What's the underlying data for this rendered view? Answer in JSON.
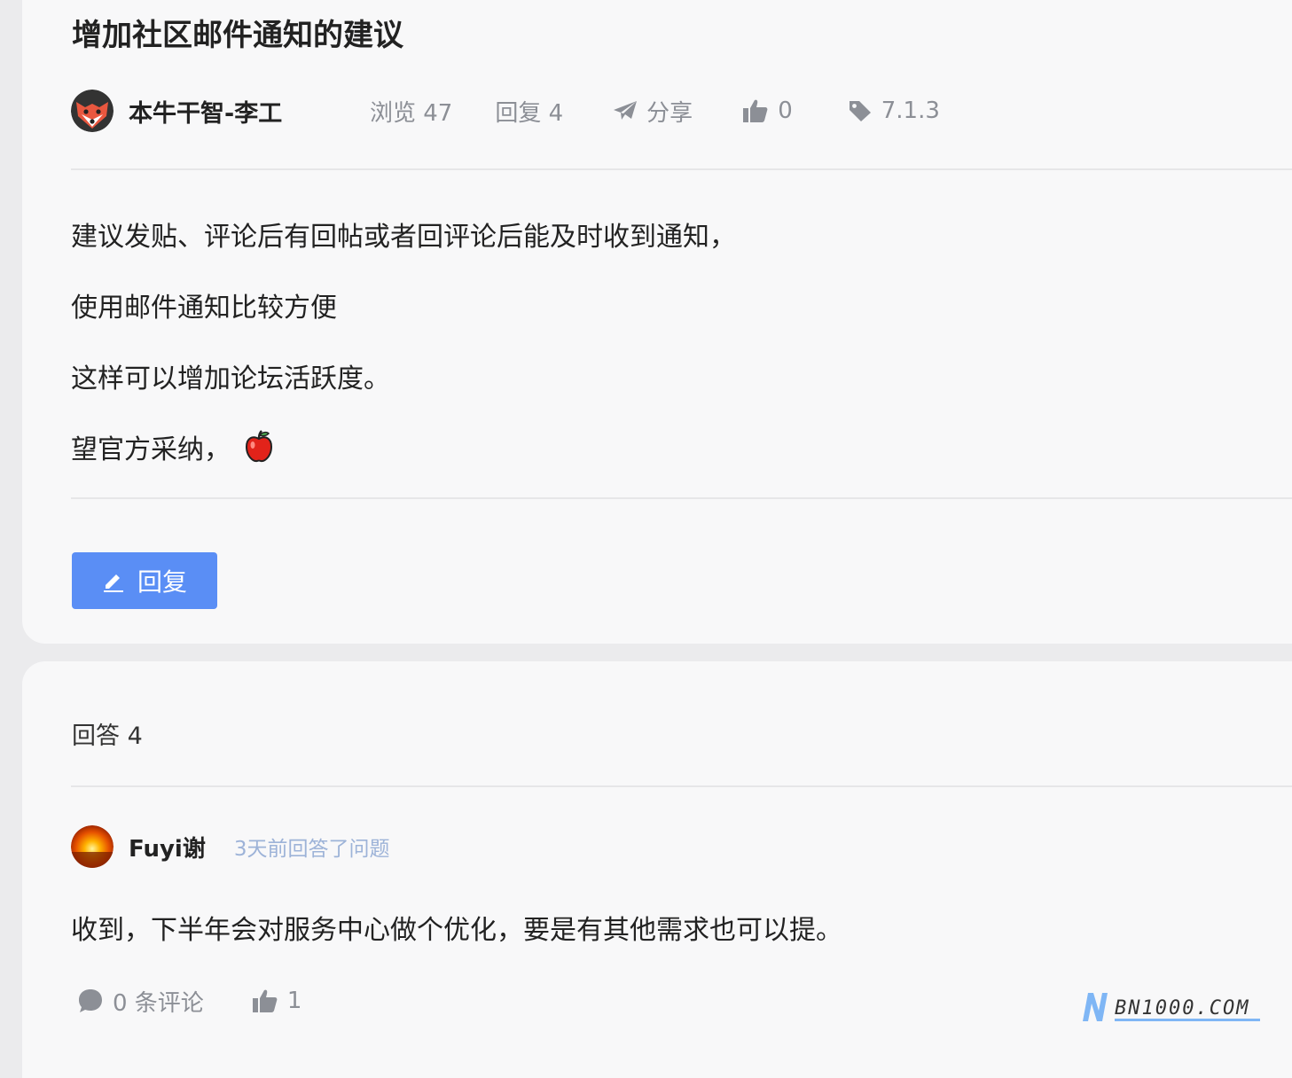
{
  "question": {
    "title": "增加社区邮件通知的建议",
    "author": "本牛干智-李工",
    "views": "浏览 47",
    "replies": "回复 4",
    "share": "分享",
    "likes": "0",
    "tag": "7.1.3",
    "body": [
      "建议发贴、评论后有回帖或者回评论后能及时收到通知，",
      "使用邮件通知比较方便",
      "这样可以增加论坛活跃度。",
      "望官方采纳，"
    ],
    "reply_button": "回复"
  },
  "answers": {
    "header": "回答 4",
    "items": [
      {
        "author": "Fuyi谢",
        "time": "3天前回答了问题",
        "body": "收到，下半年会对服务中心做个优化，要是有其他需求也可以提。",
        "comments": "0 条评论",
        "likes": "1"
      }
    ]
  },
  "watermark": "BN1000.COM",
  "colors": {
    "accent": "#5a8ef5",
    "muted": "#8c8f96",
    "time": "#9db3d8",
    "card": "#f8f8f9",
    "page": "#ebebed"
  },
  "icons": {
    "share": "paper-plane-icon",
    "likes": "thumbs-up-icon",
    "tag": "tag-icon",
    "reply": "pencil-icon",
    "comments": "comment-bubble-icon",
    "emoji": "apple-emoji-icon"
  }
}
